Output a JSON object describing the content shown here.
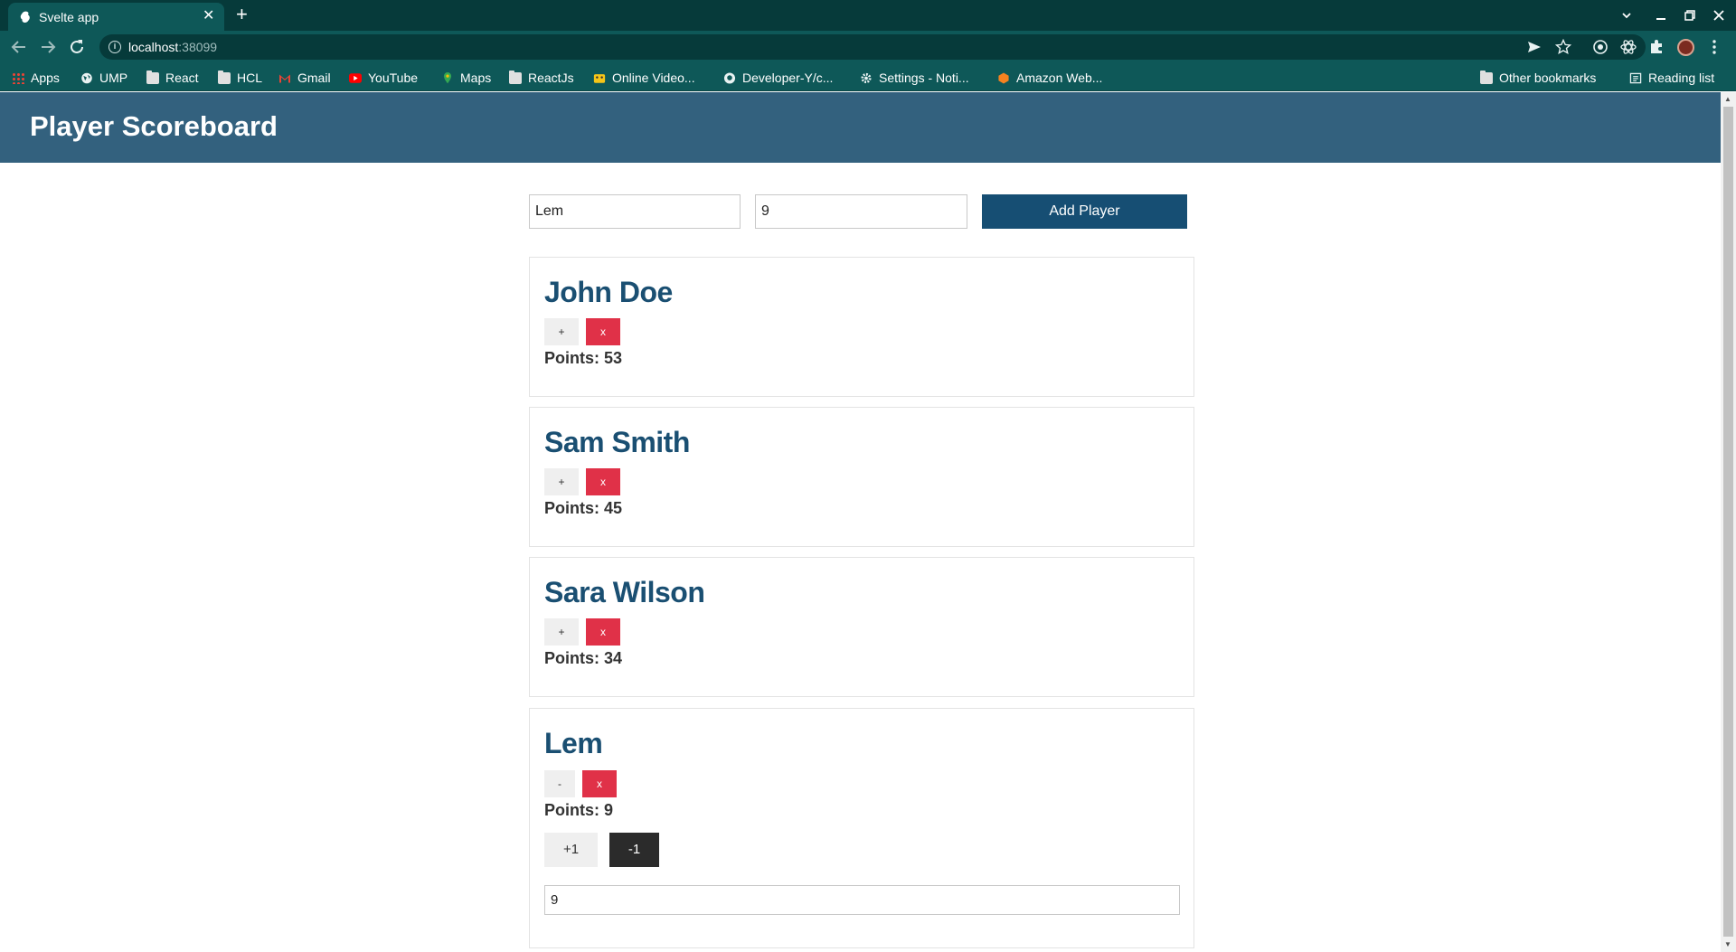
{
  "browser": {
    "tab_title": "Svelte app",
    "tab_close": "✕",
    "new_tab": "+",
    "url_host": "localhost",
    "url_port": ":38099",
    "bookmarks": [
      {
        "label": "Apps",
        "icon": "apps-grid-icon"
      },
      {
        "label": "UMP",
        "icon": "globe-icon"
      },
      {
        "label": "React",
        "icon": "folder-icon"
      },
      {
        "label": "HCL",
        "icon": "folder-icon"
      },
      {
        "label": "Gmail",
        "icon": "gmail-icon"
      },
      {
        "label": "YouTube",
        "icon": "youtube-icon"
      },
      {
        "label": "Maps",
        "icon": "maps-icon"
      },
      {
        "label": "ReactJs",
        "icon": "folder-icon"
      },
      {
        "label": "Online Video...",
        "icon": "video-icon"
      },
      {
        "label": "Developer-Y/c...",
        "icon": "github-icon"
      },
      {
        "label": "Settings - Noti...",
        "icon": "gear-icon"
      },
      {
        "label": "Amazon Web...",
        "icon": "aws-icon"
      }
    ],
    "other_bookmarks": "Other bookmarks",
    "reading_list": "Reading list"
  },
  "app": {
    "title": "Player Scoreboard",
    "form": {
      "name_value": "Lem",
      "points_value": "9",
      "add_label": "Add Player"
    },
    "players": [
      {
        "name": "John Doe",
        "toggle": "+",
        "delete": "x",
        "points_label": "Points: 53"
      },
      {
        "name": "Sam Smith",
        "toggle": "+",
        "delete": "x",
        "points_label": "Points: 45"
      },
      {
        "name": "Sara Wilson",
        "toggle": "+",
        "delete": "x",
        "points_label": "Points: 34"
      },
      {
        "name": "Lem",
        "toggle": "-",
        "delete": "x",
        "points_label": "Points: 9",
        "plus_one": "+1",
        "minus_one": "-1",
        "points_input": "9"
      }
    ]
  },
  "colors": {
    "header_bg": "#33617e",
    "accent": "#164e73",
    "name_color": "#1a4f72",
    "delete_red": "#e03148"
  }
}
